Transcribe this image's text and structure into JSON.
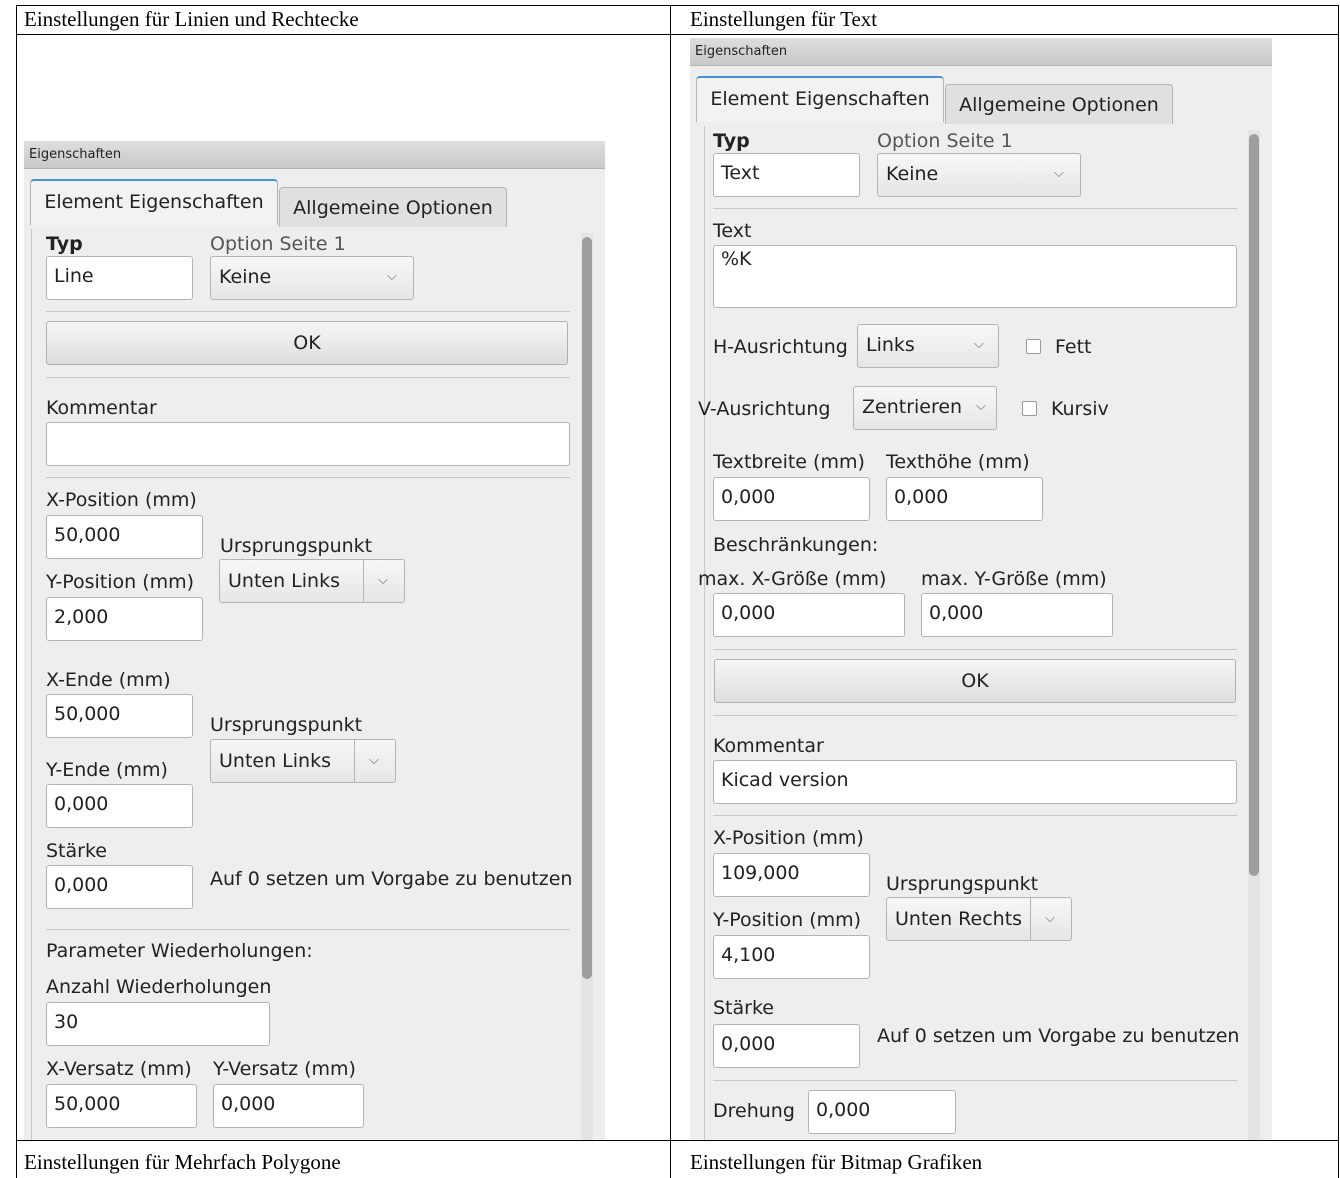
{
  "table": {
    "header_left": "Einstellungen für Linien und Rechtecke",
    "header_right": "Einstellungen für Text",
    "footer_left": "Einstellungen für Mehrfach Polygone",
    "footer_right": "Einstellungen für Bitmap Grafiken"
  },
  "left": {
    "window_title": "Eigenschaften",
    "tabs": [
      "Element Eigenschaften",
      "Allgemeine Optionen"
    ],
    "typ_label": "Typ",
    "typ_value": "Line",
    "option_label": "Option Seite 1",
    "option_value": "Keine",
    "ok_label": "OK",
    "comment_label": "Kommentar",
    "comment_value": "",
    "xpos_label": "X-Position (mm)",
    "xpos_value": "50,000",
    "origin_label": "Ursprungspunkt",
    "origin_value": "Unten Links",
    "ypos_label": "Y-Position (mm)",
    "ypos_value": "2,000",
    "xend_label": "X-Ende (mm)",
    "xend_value": "50,000",
    "origin2_label": "Ursprungspunkt",
    "origin2_value": "Unten Links",
    "yend_label": "Y-Ende (mm)",
    "yend_value": "0,000",
    "width_label": "Stärke",
    "width_value": "0,000",
    "width_hint": "Auf 0 setzen um Vorgabe zu benutzen",
    "repeat_header": "Parameter Wiederholungen:",
    "repeat_count_label": "Anzahl Wiederholungen",
    "repeat_count_value": "30",
    "xoffset_label": "X-Versatz (mm)",
    "xoffset_value": "50,000",
    "yoffset_label": "Y-Versatz (mm)",
    "yoffset_value": "0,000"
  },
  "right": {
    "window_title": "Eigenschaften",
    "tabs": [
      "Element Eigenschaften",
      "Allgemeine Optionen"
    ],
    "typ_label": "Typ",
    "typ_value": "Text",
    "option_label": "Option Seite 1",
    "option_value": "Keine",
    "text_label": "Text",
    "text_value": "%K",
    "halign_label": "H-Ausrichtung",
    "halign_value": "Links",
    "bold_label": "Fett",
    "valign_label": "V-Ausrichtung",
    "valign_value": "Zentrieren",
    "italic_label": "Kursiv",
    "textwidth_label": "Textbreite (mm)",
    "textwidth_value": "0,000",
    "textheight_label": "Texthöhe (mm)",
    "textheight_value": "0,000",
    "limits_label": "Beschränkungen:",
    "maxx_label": "max. X-Größe (mm)",
    "maxx_value": "0,000",
    "maxy_label": "max. Y-Größe (mm)",
    "maxy_value": "0,000",
    "ok_label": "OK",
    "comment_label": "Kommentar",
    "comment_value": "Kicad version",
    "xpos_label": "X-Position (mm)",
    "xpos_value": "109,000",
    "origin_label": "Ursprungspunkt",
    "origin_value": "Unten Rechts",
    "ypos_label": "Y-Position (mm)",
    "ypos_value": "4,100",
    "width_label": "Stärke",
    "width_value": "0,000",
    "width_hint": "Auf 0 setzen um Vorgabe zu benutzen",
    "rotation_label": "Drehung",
    "rotation_value": "0,000"
  },
  "icons": {
    "dropdown": "chevron-down-icon",
    "checkbox": "checkbox-icon"
  }
}
